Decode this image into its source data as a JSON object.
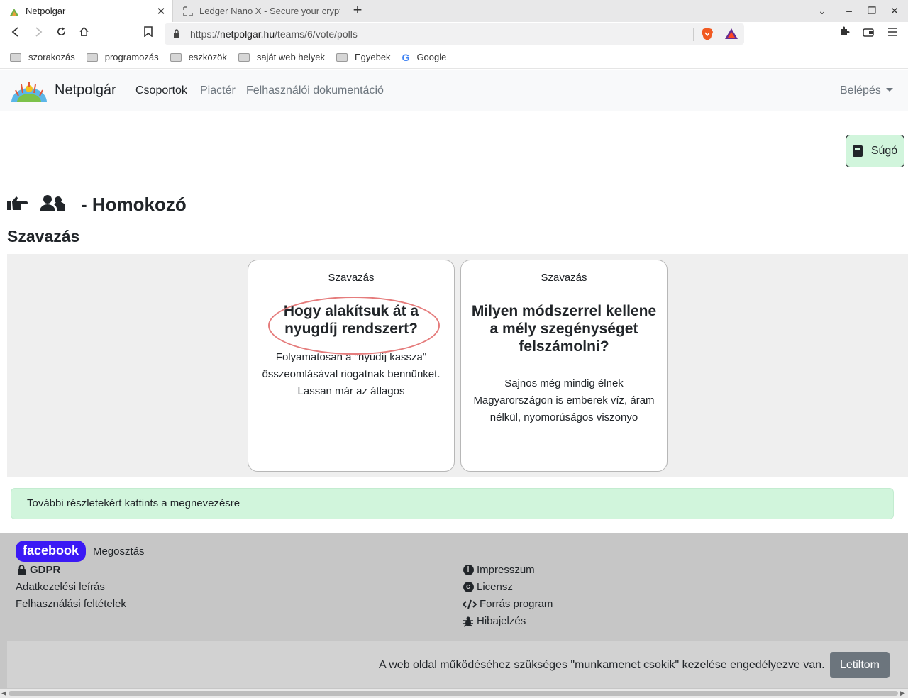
{
  "browser": {
    "tabs": [
      {
        "title": "Netpolgar",
        "active": true
      },
      {
        "title": "Ledger Nano X - Secure your crypto",
        "active": false
      }
    ],
    "url_scheme": "https://",
    "url_host": "netpolgar.hu",
    "url_path": "/teams/6/vote/polls",
    "bookmarks": [
      {
        "label": "szorakozás",
        "type": "folder"
      },
      {
        "label": "programozás",
        "type": "folder"
      },
      {
        "label": "eszközök",
        "type": "folder"
      },
      {
        "label": "saját web helyek",
        "type": "folder"
      },
      {
        "label": "Egyebek",
        "type": "folder"
      },
      {
        "label": "Google",
        "type": "link"
      }
    ]
  },
  "site_nav": {
    "brand": "Netpolgár",
    "links": [
      "Csoportok",
      "Piactér",
      "Felhasználói dokumentáció"
    ],
    "active_link": "Csoportok",
    "login": "Belépés"
  },
  "help_button": "Súgó",
  "page": {
    "title": "- Homokozó",
    "section": "Szavazás",
    "icons": [
      "hand-pointing-icon",
      "users-icon"
    ]
  },
  "polls": [
    {
      "label": "Szavazás",
      "question": "Hogy alakítsuk át a nyugdíj rendszert?",
      "description": "Folyamatosan a \"nyudíj kassza\" összeomlásával riogatnak bennünket. Lassan már az átlagos"
    },
    {
      "label": "Szavazás",
      "question": "Milyen módszerrel kellene a mély szegénységet felszámolni?",
      "description": "Sajnos még mindig élnek Magyarországon is emberek víz, áram nélkül, nyomorúságos viszonyo"
    }
  ],
  "info_message": "További részletekért kattints a megnevezésre",
  "footer": {
    "facebook": "facebook",
    "share": "Megosztás",
    "gdpr": "GDPR",
    "left_links": [
      "Adatkezelési leírás",
      "Felhasználási feltételek"
    ],
    "right_links": [
      "Impresszum",
      "Licensz",
      "Forrás program",
      "Hibajelzés"
    ]
  },
  "cookie": {
    "text": "A web oldal működéséhez szükséges \"munkamenet csokik\" kezelése engedélyezve van.",
    "button": "Letiltom"
  },
  "colors": {
    "facebook_bg": "#3b19f5",
    "help_bg": "#d1f5dc",
    "info_bg": "#d1f5dc",
    "footer_bg": "#c6c6c6",
    "highlight_ring": "#e57c7c"
  }
}
